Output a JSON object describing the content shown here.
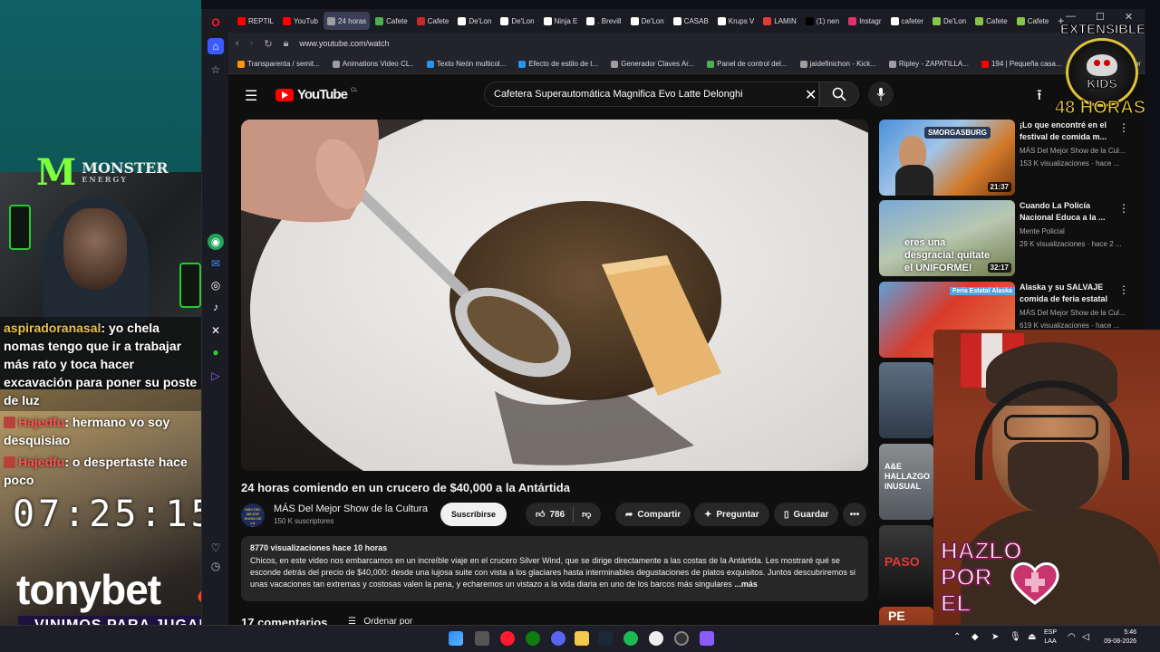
{
  "stream": {
    "chat": [
      {
        "user": "aspiradoranasal",
        "text": ": yo chela nomas tengo que ir a trabajar más rato y toca hacer excavación para poner su poste de luz"
      },
      {
        "user": "Hajedfu",
        "text": ": hermano vo soy desquisiao"
      },
      {
        "user": "Hajedfu",
        "text": ": o despertaste hace poco"
      }
    ],
    "clock": "07:25:15",
    "sponsor": "tonybet",
    "promo": "VINIMOS PARA JUGAR",
    "monster_brand": "MONSTER",
    "monster_sub": "ENERGY",
    "badge_top": "EXTENSIBLE",
    "badge_word": "KIDS",
    "badge_bottom": "48 HORAS",
    "art_text": [
      "HAZLO",
      "POR",
      "EL"
    ]
  },
  "browser": {
    "tabs": [
      {
        "label": "REPTIL",
        "color": "#ff0000"
      },
      {
        "label": "YouTub",
        "color": "#ff0000"
      },
      {
        "label": "24 horas",
        "color": "#9e9e9e",
        "active": true
      },
      {
        "label": "Cafete",
        "color": "#4caf50"
      },
      {
        "label": "Cafete",
        "color": "#c62828"
      },
      {
        "label": "De'Lon",
        "color": "#ffffff"
      },
      {
        "label": "De'Lon",
        "color": "#ffffff"
      },
      {
        "label": "Ninja E",
        "color": "#ffffff"
      },
      {
        "label": ". Brevill",
        "color": "#ffffff"
      },
      {
        "label": "De'Lon",
        "color": "#ffffff"
      },
      {
        "label": "CASAB",
        "color": "#ffffff"
      },
      {
        "label": "Krups V",
        "color": "#ffffff"
      },
      {
        "label": "LAMIN",
        "color": "#e53935"
      },
      {
        "label": "(1) nen",
        "color": "#000000"
      },
      {
        "label": "Instagr",
        "color": "#e1306c"
      },
      {
        "label": "cafeter",
        "color": "#ffffff"
      },
      {
        "label": "De'Lon",
        "color": "#8bc34a"
      },
      {
        "label": "Cafete",
        "color": "#8bc34a"
      },
      {
        "label": "Cafete",
        "color": "#8bc34a"
      }
    ],
    "url": "www.youtube.com/watch",
    "bookmarks": [
      {
        "label": "Transparenta / semit...",
        "color": "#ff9800"
      },
      {
        "label": "Animations Video CL..",
        "color": "#9e9e9e"
      },
      {
        "label": "Texto Neón multicol...",
        "color": "#2196f3"
      },
      {
        "label": "Efecto de estilo de t...",
        "color": "#2196f3"
      },
      {
        "label": "Generador Claves Ar...",
        "color": "#9e9e9e"
      },
      {
        "label": "Panel de control del...",
        "color": "#4caf50"
      },
      {
        "label": "jaidefinichon - Kick...",
        "color": "#9e9e9e"
      },
      {
        "label": "Ripley - ZAPATILLA...",
        "color": "#9e9e9e"
      },
      {
        "label": "194 | Pequeña casa...",
        "color": "#ff0000"
      },
      {
        "label": "Alien Vs Predator",
        "color": "#ff9800"
      }
    ]
  },
  "youtube": {
    "logo": "YouTube",
    "logo_region": "CL",
    "search_query": "Cafetera Superautomática Magnifica Evo Latte Delonghi",
    "video_title": "24 horas comiendo en un crucero de $40,000 a la Antártida",
    "channel_name": "MÁS Del Mejor Show de la Cultura",
    "channel_avatar_text": "MÁS DEL MEJOR SHOW DE LA CULTURA",
    "subscribers": "150 K suscriptores",
    "subscribe_label": "Suscribirse",
    "likes": "786",
    "share_label": "Compartir",
    "ask_label": "Preguntar",
    "save_label": "Guardar",
    "views_date": "8770 visualizaciones  hace 10 horas",
    "description": "Chicos, en este video nos embarcamos en un increíble viaje en el crucero Silver Wind, que se dirige directamente a las costas de la Antártida. Les mostraré qué se esconde detrás del precio de $40,000: desde una lujosa suite con vista a los glaciares hasta interminables degustaciones de platos exquisitos. Juntos descubriremos si unas vacaciones tan extremas y costosas valen la pena, y echaremos un vistazo a la vida diaria en uno de los barcos más singulares",
    "desc_more": "...más",
    "comments_label": "17 comentarios",
    "sort_label": "Ordenar por",
    "recommendations": [
      {
        "title": "¡Lo que encontré en el festival de comida m...",
        "channel": "MÁS Del Mejor Show de la Cul...",
        "meta": "153 K visualizaciones · hace ...",
        "duration": "21:37",
        "thumb_text": "SMORGASBURG"
      },
      {
        "title": "Cuando La Policía Nacional Educa a la ...",
        "channel": "Mente Policial",
        "meta": "29 K visualizaciones · hace 2 ...",
        "duration": "32:17",
        "thumb_text": "eres una desgracia! quítate el UNIFORME!"
      },
      {
        "title": "Alaska y su SALVAJE comida de feria estatal",
        "channel": "MÁS Del Mejor Show de la Cul...",
        "meta": "619 K visualizaciones · hace ...",
        "duration": "",
        "thumb_text": "Feria Estatal Alaska"
      },
      {
        "title": "",
        "channel": "",
        "meta": "",
        "duration": "",
        "thumb_text": ""
      },
      {
        "title": "",
        "channel": "",
        "meta": "",
        "duration": "",
        "thumb_text": "A&E HALLAZGO INUSUAL"
      },
      {
        "title": "",
        "channel": "",
        "meta": "",
        "duration": "",
        "thumb_text": "PASO"
      },
      {
        "title": "",
        "channel": "",
        "meta": "",
        "duration": "",
        "thumb_text": "PE"
      }
    ]
  },
  "taskbar": {
    "lang": "ESP",
    "lang_sub": "LAA",
    "time": "5:46",
    "date": "09-08-2026"
  },
  "colors": {
    "yt_red": "#ff0000",
    "accent_gold": "#e0c23a",
    "chat_user": "#e9c14b"
  }
}
